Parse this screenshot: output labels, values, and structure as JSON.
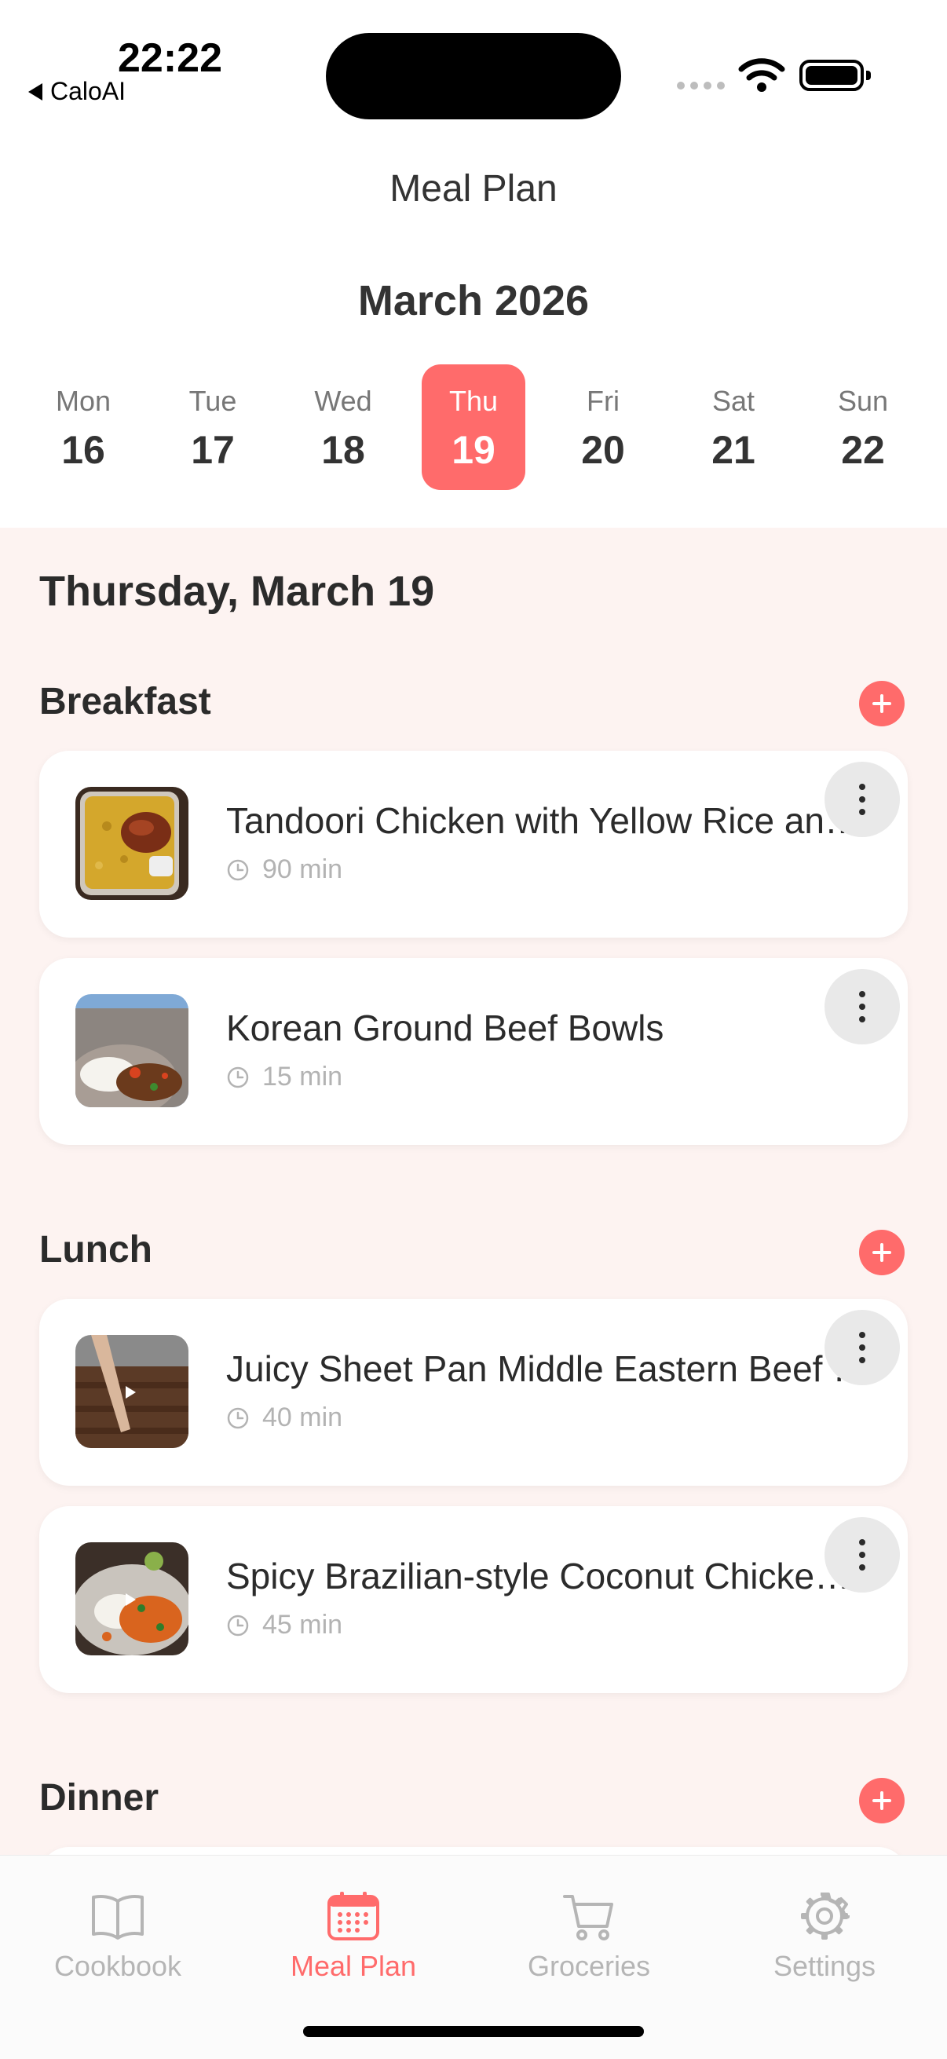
{
  "status_bar": {
    "time": "22:22",
    "back_app": "CaloAI"
  },
  "header": {
    "title": "Meal Plan",
    "month": "March 2026"
  },
  "week": [
    {
      "day": "Mon",
      "date": "16"
    },
    {
      "day": "Tue",
      "date": "17"
    },
    {
      "day": "Wed",
      "date": "18"
    },
    {
      "day": "Thu",
      "date": "19",
      "selected": true
    },
    {
      "day": "Fri",
      "date": "20"
    },
    {
      "day": "Sat",
      "date": "21"
    },
    {
      "day": "Sun",
      "date": "22"
    }
  ],
  "selected_date_heading": "Thursday, March 19",
  "sections": {
    "breakfast": {
      "title": "Breakfast",
      "items": [
        {
          "title": "Tandoori Chicken with Yellow Rice and Spiced Yogurt",
          "time": "90 min",
          "thumb_icon": "food-photo-rice-chicken"
        },
        {
          "title": "Korean Ground Beef Bowls",
          "time": "15 min",
          "thumb_icon": "food-photo-beef-bowl"
        }
      ]
    },
    "lunch": {
      "title": "Lunch",
      "items": [
        {
          "title": "Juicy Sheet Pan Middle Eastern Beef Kofta",
          "time": "40 min",
          "thumb_icon": "video-thumbnail-kofta"
        },
        {
          "title": "Spicy Brazilian-style Coconut Chicken Curry",
          "time": "45 min",
          "thumb_icon": "video-thumbnail-curry"
        }
      ]
    },
    "dinner": {
      "title": "Dinner"
    }
  },
  "tabs": [
    {
      "label": "Cookbook",
      "icon": "book-icon"
    },
    {
      "label": "Meal Plan",
      "icon": "calendar-icon",
      "active": true
    },
    {
      "label": "Groceries",
      "icon": "cart-icon"
    },
    {
      "label": "Settings",
      "icon": "gear-icon"
    }
  ],
  "colors": {
    "accent": "#ff6b6b",
    "content_background": "#fdf3f1",
    "inactive_tab": "#b5b5b5"
  }
}
